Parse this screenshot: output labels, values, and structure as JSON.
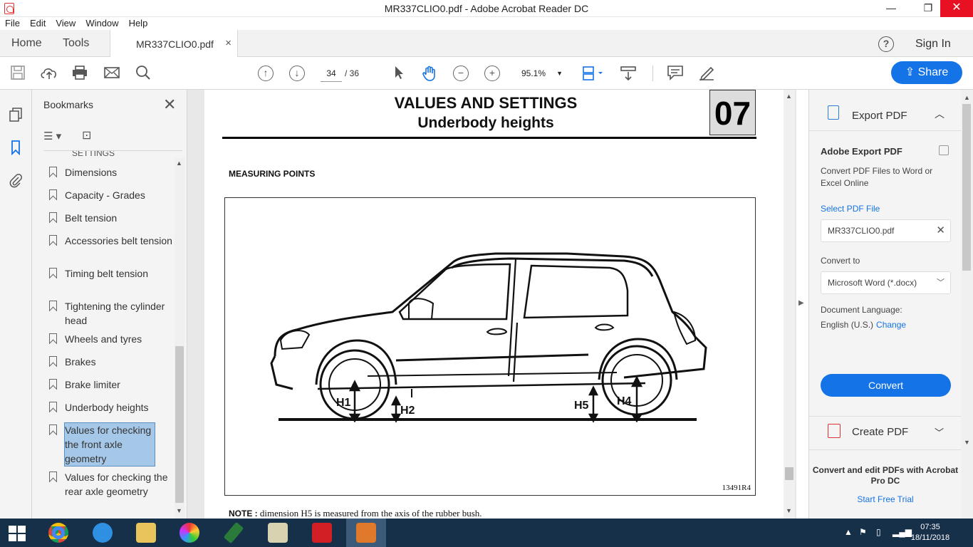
{
  "window": {
    "title": "MR337CLIO0.pdf - Adobe Acrobat Reader DC",
    "minimize": "—",
    "maximize": "❐",
    "close": "✕"
  },
  "menu": [
    "File",
    "Edit",
    "View",
    "Window",
    "Help"
  ],
  "tabs": {
    "home": "Home",
    "tools": "Tools",
    "document": "MR337CLIO0.pdf",
    "close": "×",
    "help": "?",
    "sign_in": "Sign In"
  },
  "toolbar": {
    "page_current": "34",
    "page_total": "/ 36",
    "zoom": "95.1%",
    "share_label": "Share"
  },
  "bookmarks": {
    "title": "Bookmarks",
    "cut_item": "SETTINGS",
    "items": [
      "Dimensions",
      "Capacity - Grades",
      "Belt tension",
      "Accessories belt tension",
      "Timing belt tension",
      "Tightening the cylinder head",
      "Wheels and tyres",
      "Brakes",
      "Brake limiter",
      "Underbody heights",
      "Values for checking the front axle geometry",
      "Values for checking the rear axle geometry"
    ]
  },
  "document": {
    "heading": "VALUES AND SETTINGS",
    "subheading": "Underbody heights",
    "chapter": "07",
    "section_label": "MEASURING POINTS",
    "figure_labels": [
      "H1",
      "H2",
      "H5",
      "H4"
    ],
    "figure_code": "13491R4",
    "note_label": "NOTE :",
    "note_text": "dimension H5 is measured from the axis of the rubber bush."
  },
  "right_panel": {
    "export_label": "Export PDF",
    "heading": "Adobe Export PDF",
    "description": "Convert PDF Files to Word or Excel Online",
    "select_file": "Select PDF File",
    "file_name": "MR337CLIO0.pdf",
    "convert_to_label": "Convert to",
    "convert_to_value": "Microsoft Word (*.docx)",
    "language_label": "Document Language:",
    "language_value": "English (U.S.)",
    "change_link": "Change",
    "convert_button": "Convert",
    "create_label": "Create PDF",
    "promo": "Convert and edit PDFs with Acrobat Pro DC",
    "trial": "Start Free Trial"
  },
  "taskbar": {
    "time": "07:35",
    "date": "18/11/2018"
  },
  "colors": {
    "accent": "#1473e6",
    "taskbar": "#17304a",
    "selection": "#a6c8e8"
  }
}
